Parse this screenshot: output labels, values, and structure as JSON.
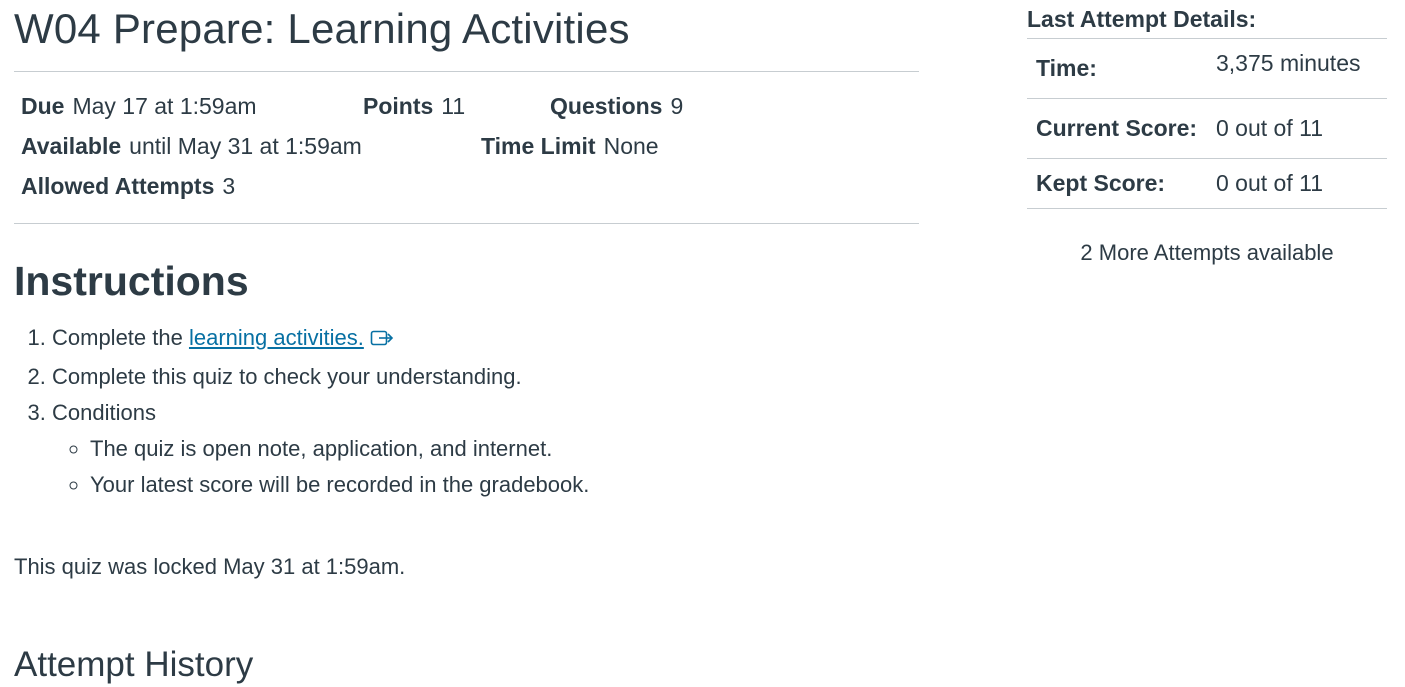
{
  "quiz": {
    "title": "W04 Prepare: Learning Activities",
    "due_label": "Due",
    "due_value": "May 17 at 1:59am",
    "points_label": "Points",
    "points_value": "11",
    "questions_label": "Questions",
    "questions_value": "9",
    "available_label": "Available",
    "available_value": "until May 31 at 1:59am",
    "time_limit_label": "Time Limit",
    "time_limit_value": "None",
    "allowed_attempts_label": "Allowed Attempts",
    "allowed_attempts_value": "3"
  },
  "instructions": {
    "heading": "Instructions",
    "item1_prefix": "Complete the ",
    "item1_link": "learning activities.",
    "item1_icon": "external-link-icon",
    "item2": "Complete this quiz to check your understanding.",
    "item3": "Conditions",
    "sub_items": [
      "The quiz is open note, application, and internet.",
      "Your latest score will be recorded in the gradebook."
    ]
  },
  "locked_message": "This quiz was locked May 31 at 1:59am.",
  "attempt_history_heading": "Attempt History",
  "last_attempt": {
    "heading": "Last Attempt Details:",
    "time_label": "Time:",
    "time_value": "3,375 minutes",
    "current_score_label": "Current Score:",
    "current_score_value": "0 out of 11",
    "kept_score_label": "Kept Score:",
    "kept_score_value": "0 out of 11",
    "more_attempts": "2 More Attempts available"
  },
  "colors": {
    "text": "#2d3b45",
    "link": "#0770a3",
    "divider": "#c7cdd1"
  }
}
